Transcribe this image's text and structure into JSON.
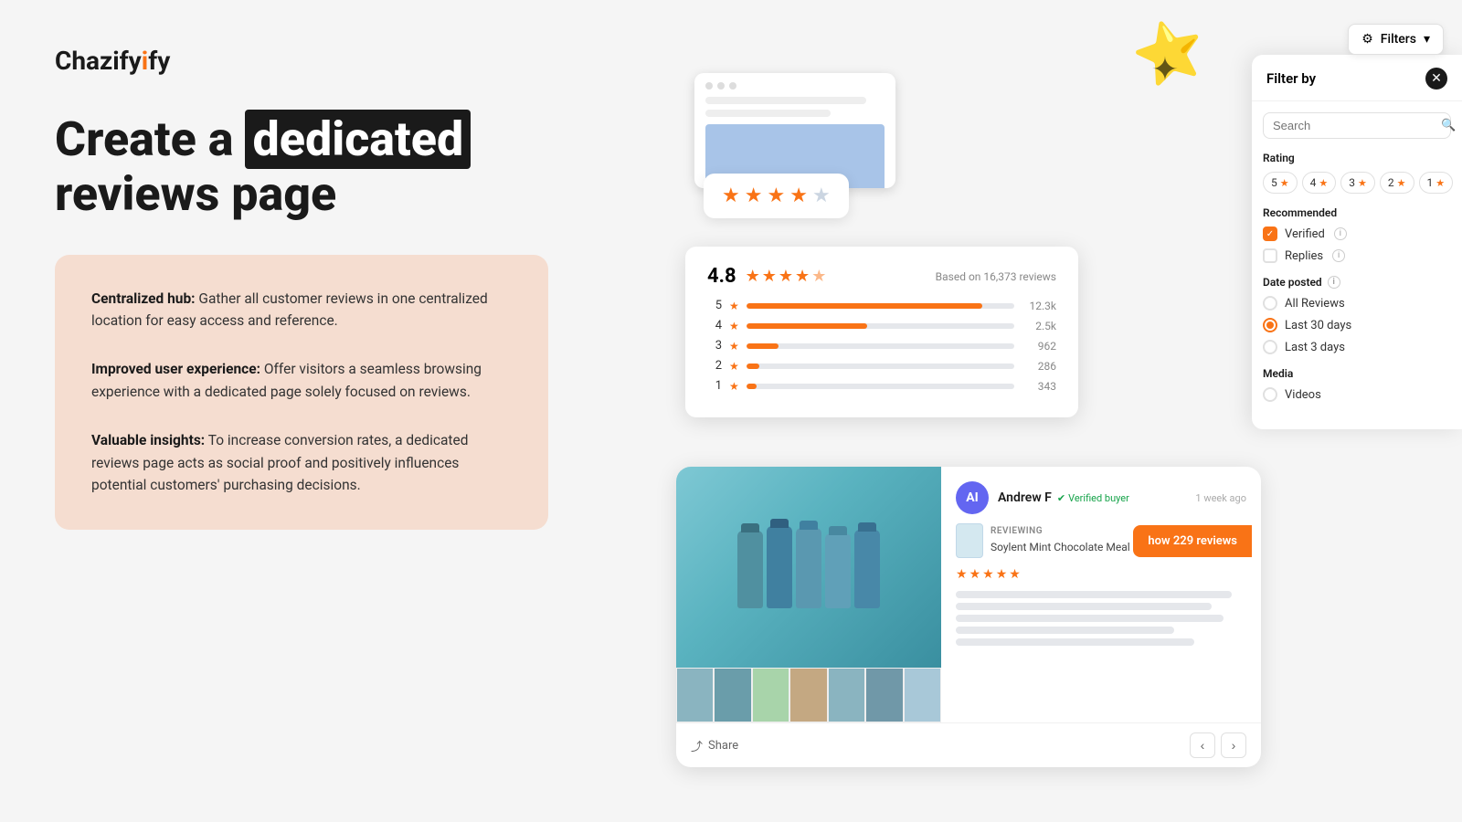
{
  "logo": {
    "text": "Chazify"
  },
  "headline": {
    "prefix": "Create a ",
    "highlight": "dedicated",
    "suffix": " reviews page"
  },
  "features": [
    {
      "bold": "Centralized hub:",
      "text": " Gather all customer reviews in one centralized location for easy access and reference."
    },
    {
      "bold": "Improved user experience:",
      "text": " Offer visitors a seamless browsing experience with a dedicated page solely focused on reviews."
    },
    {
      "bold": "Valuable insights:",
      "text": " To increase conversion rates, a dedicated reviews page acts as social proof and positively influences potential customers' purchasing decisions."
    }
  ],
  "rating_widget": {
    "score": "4.8",
    "subtitle": "Based on 16,373 reviews",
    "bars": [
      {
        "label": "5",
        "width": "88",
        "count": "12.3k"
      },
      {
        "label": "4",
        "width": "45",
        "count": "2.5k"
      },
      {
        "label": "3",
        "width": "12",
        "count": "962"
      },
      {
        "label": "2",
        "width": "5",
        "count": "286"
      },
      {
        "label": "1",
        "width": "4",
        "count": "343"
      }
    ]
  },
  "filters": {
    "title": "Filter by",
    "search_placeholder": "Search",
    "toggle_label": "Filters",
    "sections": {
      "rating": {
        "label": "Rating",
        "chips": [
          "5",
          "4",
          "3",
          "2",
          "1"
        ]
      },
      "recommended": {
        "label": "Recommended",
        "options": [
          {
            "label": "Verified",
            "checked": true
          },
          {
            "label": "Replies",
            "checked": false
          }
        ]
      },
      "date_posted": {
        "label": "Date posted",
        "options": [
          {
            "label": "All Reviews",
            "active": false
          },
          {
            "label": "Last 30 days",
            "active": true
          },
          {
            "label": "Last 3 days",
            "active": false
          }
        ]
      },
      "media": {
        "label": "Media",
        "options": [
          {
            "label": "Videos",
            "active": false
          }
        ]
      }
    }
  },
  "review": {
    "reviewer_initials": "AI",
    "reviewer_name": "Andrew F",
    "verified_label": "Verified buyer",
    "time": "1 week ago",
    "reviewing_label": "Reviewing",
    "product_name": "Soylent Mint Chocolate Meal Replacement Shake",
    "share_label": "Share",
    "show_reviews_label": "how 229 reviews"
  }
}
